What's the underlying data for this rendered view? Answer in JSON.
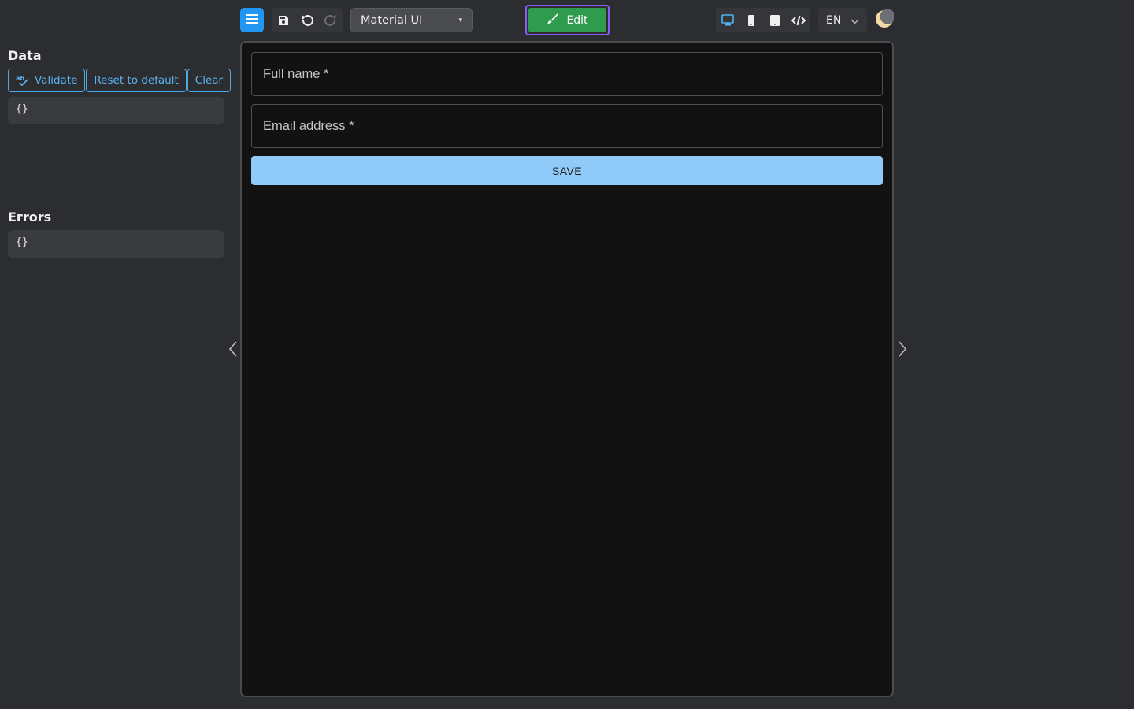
{
  "data_panel": {
    "title": "Data",
    "buttons": {
      "validate": "Validate",
      "reset": "Reset to default",
      "clear": "Clear"
    },
    "json": "{}"
  },
  "errors_panel": {
    "title": "Errors",
    "json": "{}"
  },
  "toolbar": {
    "menu_icon": "hamburger-menu-icon",
    "actions": [
      "save-icon",
      "undo-icon",
      "redo-icon"
    ],
    "theme_select": {
      "value": "Material UI",
      "caret": "▾"
    },
    "edit_button": {
      "label": "Edit",
      "icon": "brush-icon",
      "color": "#2e9b4e",
      "focus_color": "#8b5cf6"
    },
    "views": [
      "desktop-icon",
      "phone-icon",
      "tablet-icon",
      "code-icon"
    ],
    "language": {
      "value": "EN"
    },
    "theme_toggle_icon": "moon-icon"
  },
  "form": {
    "fields": [
      {
        "label": "Full name *"
      },
      {
        "label": "Email address *"
      }
    ],
    "submit_label": "SAVE",
    "submit_color": "#90caf9"
  },
  "colors": {
    "accent": "#2196f3",
    "outline": "#4fa8e6",
    "background": "#2c2d31",
    "canvas": "#121212"
  }
}
